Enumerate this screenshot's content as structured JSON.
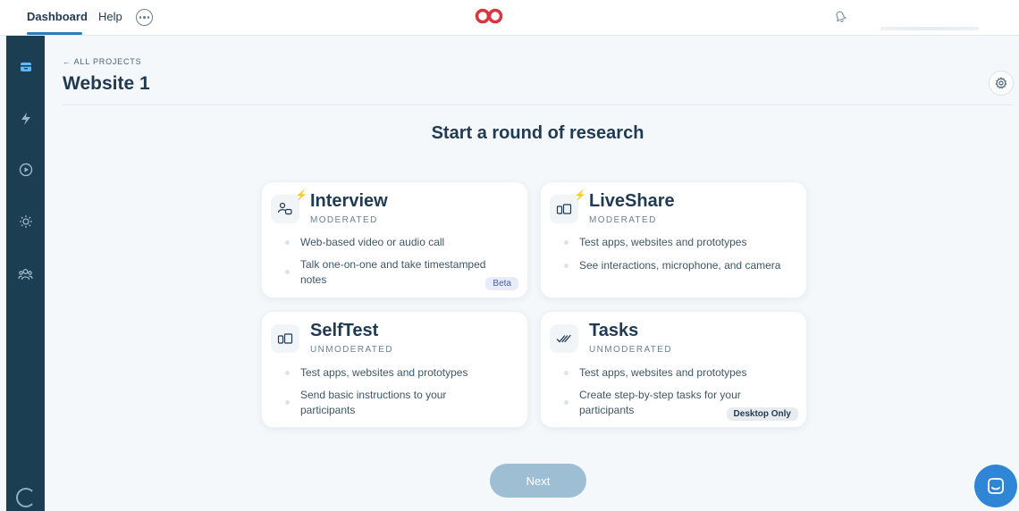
{
  "topbar": {
    "nav": [
      "Dashboard",
      "Help"
    ],
    "more_icon": "more-horizontal-icon",
    "logo_icon": "brand-logo",
    "bell_icon": "bell-icon"
  },
  "sidebar": {
    "items": [
      "inbox-icon",
      "bolt-icon",
      "play-icon",
      "sun-icon",
      "team-icon"
    ],
    "loading_icon": "spinner-icon"
  },
  "header": {
    "back_label": "← ALL PROJECTS",
    "title": "Website 1",
    "settings_icon": "gear-icon"
  },
  "main": {
    "section_title": "Start a round of research",
    "cards": [
      {
        "title": "Interview",
        "subtitle": "MODERATED",
        "bullets": [
          "Web-based video or audio call",
          "Talk one-on-one and take timestamped notes"
        ],
        "badge": "Beta"
      },
      {
        "title": "LiveShare",
        "subtitle": "MODERATED",
        "bullets": [
          "Test apps, websites and prototypes",
          "See interactions, microphone, and camera"
        ]
      },
      {
        "title": "SelfTest",
        "subtitle": "UNMODERATED",
        "bullets": [
          "Test apps, websites and prototypes",
          "Send basic instructions to your participants"
        ]
      },
      {
        "title": "Tasks",
        "subtitle": "UNMODERATED",
        "bullets": [
          "Test apps, websites and prototypes",
          "Create step-by-step tasks for your participants"
        ],
        "badge": "Desktop Only"
      }
    ],
    "next_label": "Next"
  },
  "colors": {
    "sidebar": "#1c3e52",
    "accent": "#2f7db8",
    "logo": "#d9343f",
    "next_button": "#9ebfd3",
    "chat_button": "#2f86d6"
  }
}
